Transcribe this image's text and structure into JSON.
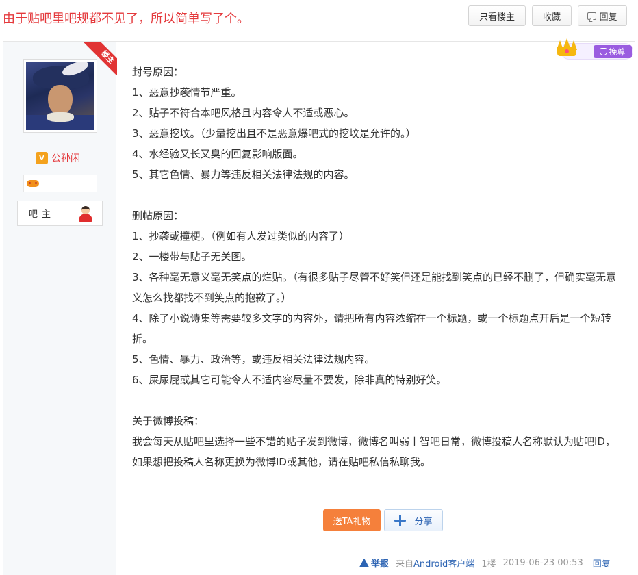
{
  "header": {
    "title": "由于贴吧里吧规都不见了，所以简单写了个。",
    "only_op_label": "只看楼主",
    "favorite_label": "收藏",
    "reply_label": "回复"
  },
  "author": {
    "op_tag": "楼主",
    "vip_badge": "V",
    "username": "公孙闲",
    "role": "吧主"
  },
  "badge": {
    "pick_label": "挽尊"
  },
  "content": {
    "section1_title": "封号原因：",
    "section1_items": [
      "1、恶意抄袭情节严重。",
      "2、贴子不符合本吧风格且内容令人不适或恶心。",
      "3、恶意挖坟。（少量挖出且不是恶意爆吧式的挖坟是允许的。）",
      "4、水经验又长又臭的回复影响版面。",
      "5、其它色情、暴力等违反相关法律法规的内容。"
    ],
    "section2_title": "删帖原因：",
    "section2_items": [
      "1、抄袭或撞梗。（例如有人发过类似的内容了）",
      "2、一楼带与贴子无关图。",
      "3、各种毫无意义毫无笑点的烂贴。（有很多贴子尽管不好笑但还是能找到笑点的已经不删了，但确实毫无意义怎么找都找不到笑点的抱歉了。）",
      "4、除了小说诗集等需要较多文字的内容外，请把所有内容浓缩在一个标题，或一个标题点开后是一个短转折。",
      "5、色情、暴力、政治等，或违反相关法律法规内容。",
      "6、屎尿屁或其它可能令人不适内容尽量不要发，除非真的特别好笑。"
    ],
    "section3_title": "关于微博投稿：",
    "section3_text": "我会每天从贴吧里选择一些不错的贴子发到微博，微博名叫弱丨智吧日常，微博投稿人名称默认为贴吧ID，如果想把投稿人名称更换为微博ID或其他，请在贴吧私信私聊我。"
  },
  "actions": {
    "gift_label": "送TA礼物",
    "share_label": "分享"
  },
  "tail": {
    "report_label": "举报",
    "from_prefix": "来自",
    "from_client": "Android客户端",
    "floor": "1楼",
    "time": "2019-06-23 00:53",
    "reply_label": "回复"
  },
  "colors": {
    "title_red": "#e4393c",
    "link_blue": "#2d64b3",
    "gift_orange": "#f5803b",
    "pick_purple": "#9a5ce0"
  }
}
